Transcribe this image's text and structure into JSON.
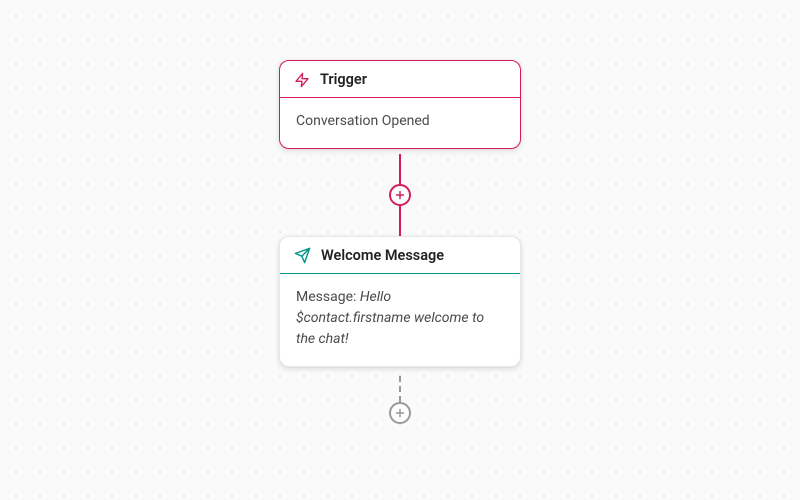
{
  "trigger": {
    "title": "Trigger",
    "event": "Conversation Opened"
  },
  "action": {
    "title": "Welcome Message",
    "fieldLabel": "Message:",
    "messageValue": "Hello $contact.firstname welcome to the chat!"
  },
  "colors": {
    "trigger": "#d81b60",
    "action": "#009688"
  }
}
